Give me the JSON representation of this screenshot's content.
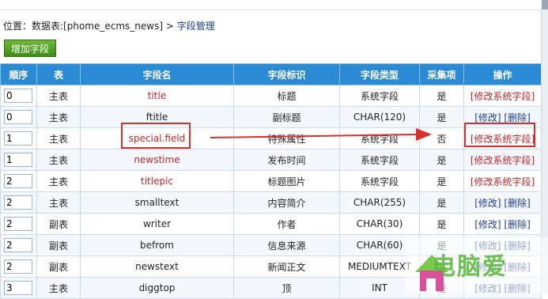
{
  "breadcrumb": {
    "prefix": "位置：数据表:[phome_ecms_news] > ",
    "current": "字段管理"
  },
  "toolbar": {
    "add_label": "增加字段"
  },
  "table": {
    "headers": [
      "顺序",
      "表",
      "字段名",
      "字段标识",
      "字段类型",
      "采集项",
      "操作"
    ],
    "rows": [
      {
        "order": "0",
        "table": "主表",
        "name": "title",
        "label": "标题",
        "type": "系统字段",
        "collect": "是",
        "action1": "[修改系统字段]",
        "action2": "",
        "system": true
      },
      {
        "order": "0",
        "table": "主表",
        "name": "ftitle",
        "label": "副标题",
        "type": "CHAR(120)",
        "collect": "是",
        "action1": "[修改]",
        "action2": "[删除]",
        "system": false
      },
      {
        "order": "1",
        "table": "主表",
        "name": "special.field",
        "label": "特殊属性",
        "type": "系统字段",
        "collect": "否",
        "action1": "[修改系统字段]",
        "action2": "",
        "system": true
      },
      {
        "order": "1",
        "table": "主表",
        "name": "newstime",
        "label": "发布时间",
        "type": "系统字段",
        "collect": "是",
        "action1": "[修改系统字段]",
        "action2": "",
        "system": true
      },
      {
        "order": "2",
        "table": "主表",
        "name": "titlepic",
        "label": "标题图片",
        "type": "系统字段",
        "collect": "是",
        "action1": "[修改系统字段]",
        "action2": "",
        "system": true
      },
      {
        "order": "2",
        "table": "主表",
        "name": "smalltext",
        "label": "内容简介",
        "type": "CHAR(255)",
        "collect": "是",
        "action1": "[修改]",
        "action2": "[删除]",
        "system": false
      },
      {
        "order": "2",
        "table": "副表",
        "name": "writer",
        "label": "作者",
        "type": "CHAR(30)",
        "collect": "是",
        "action1": "[修改]",
        "action2": "[删除]",
        "system": false
      },
      {
        "order": "2",
        "table": "副表",
        "name": "befrom",
        "label": "信息来源",
        "type": "CHAR(60)",
        "collect": "是",
        "action1": "[修改]",
        "action2": "[删除]",
        "system": false
      },
      {
        "order": "2",
        "table": "副表",
        "name": "newstext",
        "label": "新闻正文",
        "type": "MEDIUMTEXT",
        "collect": "是",
        "action1": "[修改]",
        "action2": "[删除]",
        "system": false
      },
      {
        "order": "3",
        "table": "主表",
        "name": "diggtop",
        "label": "顶",
        "type": "INT",
        "collect": "是",
        "action1": "[修改]",
        "action2": "[删除]",
        "system": false
      }
    ]
  },
  "watermark": {
    "text": "电脑爱"
  },
  "colors": {
    "header_bg": "#2a8ad4",
    "system_field_red": "#c8262a",
    "link_blue": "#1a3c8c",
    "button_green": "#4a9a22",
    "highlight_red": "#d9302c"
  }
}
